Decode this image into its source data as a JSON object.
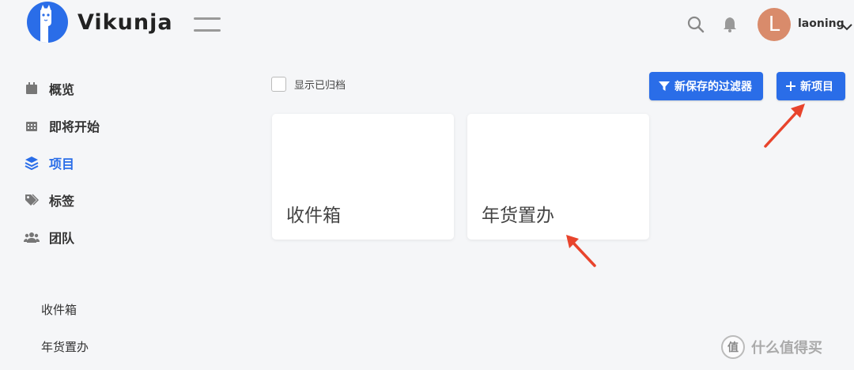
{
  "header": {
    "app_name": "Vikunja",
    "avatar_letter": "L",
    "username": "laoning",
    "icons": [
      "menu-icon",
      "search-icon",
      "bell-icon",
      "chevron-down-icon"
    ]
  },
  "sidebar": {
    "items": [
      {
        "label": "概览",
        "icon": "calendar-icon"
      },
      {
        "label": "即将开始",
        "icon": "calendar-grid-icon"
      },
      {
        "label": "项目",
        "icon": "layers-icon",
        "active": true
      },
      {
        "label": "标签",
        "icon": "tags-icon"
      },
      {
        "label": "团队",
        "icon": "users-icon"
      }
    ],
    "projects": [
      "收件箱",
      "年货置办"
    ]
  },
  "main": {
    "show_archived_label": "显示已归档",
    "filter_button_label": "新保存的过滤器",
    "new_project_button_label": "新项目",
    "cards": [
      {
        "title": "收件箱"
      },
      {
        "title": "年货置办"
      }
    ]
  },
  "watermark": {
    "badge": "值",
    "text": "什么值得买"
  },
  "colors": {
    "accent": "#2a6de8",
    "annotation_arrow": "#e8442c",
    "avatar": "#d98b6b",
    "background": "#f5f6f8"
  }
}
